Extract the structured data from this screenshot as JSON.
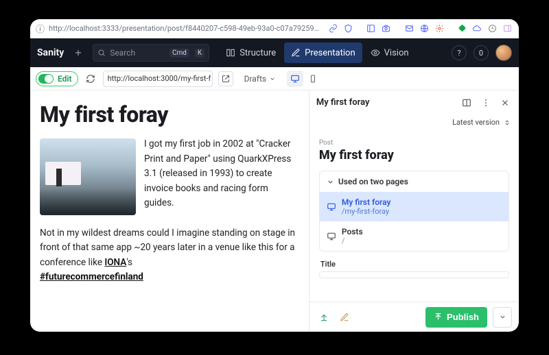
{
  "browser": {
    "url": "http://localhost:3333/presentation/post/f8440207-c598-49eb-93a0-c07a792599e2?previ…"
  },
  "topbar": {
    "brand": "Sanity",
    "search_placeholder": "Search",
    "kbd1": "Cmd",
    "kbd2": "K",
    "tabs": {
      "structure": "Structure",
      "presentation": "Presentation",
      "vision": "Vision"
    },
    "notification_count": "0"
  },
  "subbar": {
    "edit_label": "Edit",
    "preview_url": "http://localhost:3000/my-first-f",
    "drafts_label": "Drafts"
  },
  "preview": {
    "heading": "My first foray",
    "p1": "I got my first job in 2002 at \"Cracker Print and Paper\" using QuarkXPress 3.1 (released in 1993) to create invoice books and racing form guides.",
    "p2a": "Not in my wildest dreams could I imagine standing on stage in front of that same app ~20 years later in a venue like this for a conference like ",
    "link1": "IONA",
    "p2b": "'s ",
    "hashtag": "#futurecommercefinland"
  },
  "panel": {
    "doc_title": "My first foray",
    "version_label": "Latest version",
    "type_label": "Post",
    "heading": "My first foray",
    "used_on": "Used on two pages",
    "pages": [
      {
        "title": "My first foray",
        "path": "/my-first-foray",
        "selected": true
      },
      {
        "title": "Posts",
        "path": "/",
        "selected": false
      }
    ],
    "title_field_label": "Title",
    "publish_label": "Publish"
  }
}
